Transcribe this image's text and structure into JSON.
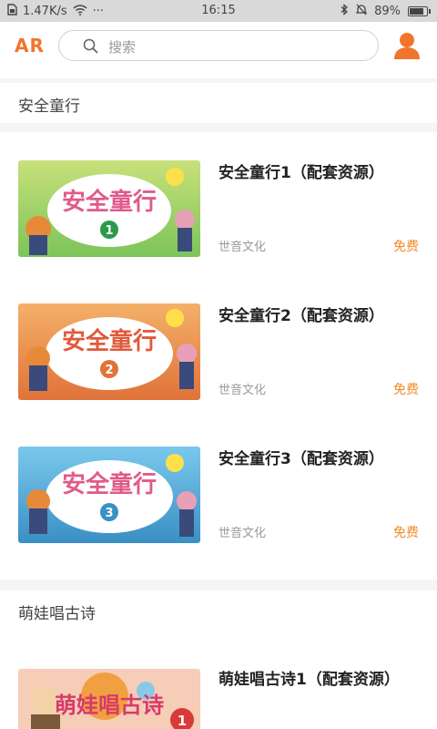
{
  "status_bar": {
    "speed": "1.47K/s",
    "dots": "···",
    "time": "16:15",
    "battery": "89%",
    "battery_level": 0.89
  },
  "top_bar": {
    "logo": "AR",
    "search_placeholder": "搜索"
  },
  "sections": [
    {
      "title": "安全童行",
      "items": [
        {
          "title": "安全童行1（配套资源）",
          "publisher": "世音文化",
          "price": "免费",
          "thumb_text": "安全童行",
          "number": "1",
          "thumb_colors": [
            "#c6de6a",
            "#6cc06a"
          ]
        },
        {
          "title": "安全童行2（配套资源）",
          "publisher": "世音文化",
          "price": "免费",
          "thumb_text": "安全童行",
          "number": "2",
          "thumb_colors": [
            "#f2a65a",
            "#e37c3e"
          ]
        },
        {
          "title": "安全童行3（配套资源）",
          "publisher": "世音文化",
          "price": "免费",
          "thumb_text": "安全童行",
          "number": "3",
          "thumb_colors": [
            "#6fc0e8",
            "#3b94c9"
          ]
        }
      ]
    },
    {
      "title": "萌娃唱古诗",
      "items": [
        {
          "title": "萌娃唱古诗1（配套资源）",
          "publisher": "",
          "price": "",
          "thumb_text": "萌娃唱古诗",
          "number": "1",
          "thumb_colors": [
            "#f5c9b0",
            "#f3b59a"
          ]
        }
      ]
    }
  ],
  "colors": {
    "accent": "#f0752c",
    "price": "#f08a2a"
  }
}
